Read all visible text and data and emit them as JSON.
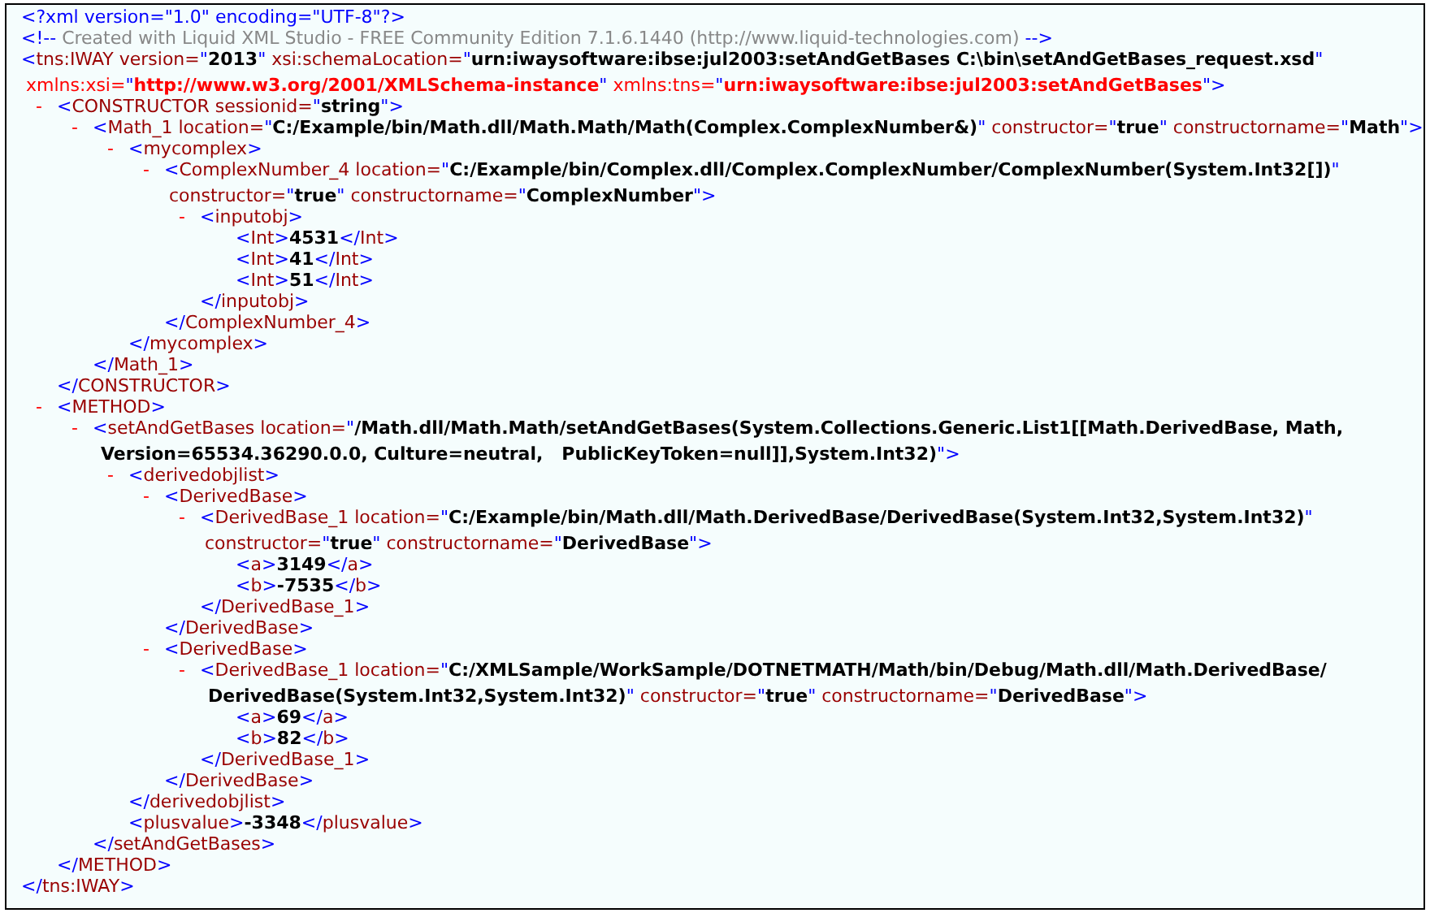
{
  "syntax": {
    "lt": "<",
    "gt": ">",
    "lt_slash": "</",
    "eq": "=",
    "quote": "\""
  },
  "declaration": "<?xml version=\"1.0\" encoding=\"UTF-8\"?>",
  "comment": {
    "open": "<!--",
    "text": "Created with Liquid XML Studio - FREE Community Edition 7.1.6.1440 (http://www.liquid-technologies.com)",
    "close": "-->"
  },
  "root": {
    "tag": "tns:IWAY",
    "end_tag": "tns:IWAY",
    "attributes": [
      {
        "name": "version",
        "value": [
          "2013"
        ],
        "kind": "plain"
      },
      {
        "name": "xsi:schemaLocation",
        "value": [
          "urn:iwaysoftware:ibse:jul2003:setAndGetBases C:\\bin\\setAndGetBases_request.xsd"
        ],
        "kind": "plain"
      },
      {
        "name": "xmlns:xsi",
        "value": [
          "http://www.w3.org/2001/XMLSchema-instance"
        ],
        "kind": "namespace",
        "break_before": true
      },
      {
        "name": "xmlns:tns",
        "value": [
          "urn:iwaysoftware:ibse:jul2003:setAndGetBases"
        ],
        "kind": "namespace"
      }
    ],
    "children": [
      {
        "tag": "CONSTRUCTOR",
        "end_tag": "CONSTRUCTOR",
        "toggle": "-",
        "attributes": [
          {
            "name": "sessionid",
            "value": [
              "string"
            ],
            "kind": "plain"
          }
        ],
        "children": [
          {
            "tag": "Math_1",
            "end_tag": "Math_1",
            "toggle": "-",
            "attributes": [
              {
                "name": "location",
                "value": [
                  "C:/Example/bin/Math.dll/Math.Math/Math(Complex.ComplexNumber&)"
                ],
                "kind": "plain"
              },
              {
                "name": "constructor",
                "value": [
                  "true"
                ],
                "kind": "plain"
              },
              {
                "name": "constructorname",
                "value": [
                  "Math"
                ],
                "kind": "plain"
              }
            ],
            "children": [
              {
                "tag": "mycomplex",
                "end_tag": "mycomplex",
                "toggle": "-",
                "children": [
                  {
                    "tag": "ComplexNumber_4",
                    "end_tag": "ComplexNumber_4",
                    "toggle": "-",
                    "attributes": [
                      {
                        "name": "location",
                        "value": [
                          "C:/Example/bin/Complex.dll/Complex.ComplexNumber/ComplexNumber(System.Int32[])"
                        ],
                        "kind": "plain"
                      },
                      {
                        "name": "constructor",
                        "value": [
                          "true"
                        ],
                        "kind": "plain",
                        "break_before": true
                      },
                      {
                        "name": "constructorname",
                        "value": [
                          "ComplexNumber"
                        ],
                        "kind": "plain"
                      }
                    ],
                    "children": [
                      {
                        "tag": "inputobj",
                        "end_tag": "inputobj",
                        "toggle": "-",
                        "children": [
                          {
                            "tag": "Int",
                            "text": "4531",
                            "end_tag": "Int"
                          },
                          {
                            "tag": "Int",
                            "text": "41",
                            "end_tag": "Int"
                          },
                          {
                            "tag": "Int",
                            "text": "51",
                            "end_tag": "Int"
                          }
                        ]
                      }
                    ]
                  }
                ]
              }
            ]
          }
        ]
      },
      {
        "tag": "METHOD",
        "end_tag": "METHOD",
        "toggle": "-",
        "children": [
          {
            "tag": "setAndGetBases",
            "end_tag": "setAndGetBases",
            "toggle": "-",
            "attributes": [
              {
                "name": "location",
                "value": [
                  "/Math.dll/Math.Math/setAndGetBases(System.Collections.Generic.List1[[Math.DerivedBase, Math,",
                  "Version=65534.36290.0.0, Culture=neutral,   PublicKeyToken=null]],System.Int32)"
                ],
                "kind": "plain"
              }
            ],
            "children": [
              {
                "tag": "derivedobjlist",
                "end_tag": "derivedobjlist",
                "toggle": "-",
                "children": [
                  {
                    "tag": "DerivedBase",
                    "end_tag": "DerivedBase",
                    "toggle": "-",
                    "children": [
                      {
                        "tag": "DerivedBase_1",
                        "end_tag": "DerivedBase_1",
                        "toggle": "-",
                        "attributes": [
                          {
                            "name": "location",
                            "value": [
                              "C:/Example/bin/Math.dll/Math.DerivedBase/DerivedBase(System.Int32,System.Int32)"
                            ],
                            "kind": "plain"
                          },
                          {
                            "name": "constructor",
                            "value": [
                              "true"
                            ],
                            "kind": "plain",
                            "break_before": true
                          },
                          {
                            "name": "constructorname",
                            "value": [
                              "DerivedBase"
                            ],
                            "kind": "plain"
                          }
                        ],
                        "children": [
                          {
                            "tag": "a",
                            "text": "3149",
                            "end_tag": "a"
                          },
                          {
                            "tag": "b",
                            "text": "-7535",
                            "end_tag": "b"
                          }
                        ]
                      }
                    ]
                  },
                  {
                    "tag": "DerivedBase",
                    "end_tag": "DerivedBase",
                    "toggle": "-",
                    "children": [
                      {
                        "tag": "DerivedBase_1",
                        "end_tag": "DerivedBase_1",
                        "toggle": "-",
                        "attributes": [
                          {
                            "name": "location",
                            "value": [
                              "C:/XMLSample/WorkSample/DOTNETMATH/Math/bin/Debug/Math.dll/Math.DerivedBase/",
                              "DerivedBase(System.Int32,System.Int32)"
                            ],
                            "kind": "plain"
                          },
                          {
                            "name": "constructor",
                            "value": [
                              "true"
                            ],
                            "kind": "plain"
                          },
                          {
                            "name": "constructorname",
                            "value": [
                              "DerivedBase"
                            ],
                            "kind": "plain"
                          }
                        ],
                        "children": [
                          {
                            "tag": "a",
                            "text": "69",
                            "end_tag": "a"
                          },
                          {
                            "tag": "b",
                            "text": "82",
                            "end_tag": "b"
                          }
                        ]
                      }
                    ]
                  }
                ]
              },
              {
                "tag": "plusvalue",
                "text": "-3348",
                "end_tag": "plusvalue"
              }
            ]
          }
        ]
      }
    ]
  }
}
